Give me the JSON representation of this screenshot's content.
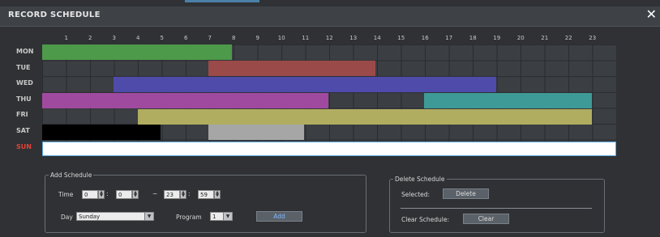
{
  "window": {
    "title": "RECORD SCHEDULE",
    "close_symbol": "✕"
  },
  "hours": [
    "1",
    "2",
    "3",
    "4",
    "5",
    "6",
    "7",
    "8",
    "9",
    "10",
    "11",
    "12",
    "13",
    "14",
    "15",
    "16",
    "17",
    "18",
    "19",
    "20",
    "21",
    "22",
    "23"
  ],
  "days": [
    {
      "label": "MON",
      "color": "#c8c8c8"
    },
    {
      "label": "TUE",
      "color": "#c8c8c8"
    },
    {
      "label": "WED",
      "color": "#c8c8c8"
    },
    {
      "label": "THU",
      "color": "#c8c8c8"
    },
    {
      "label": "FRI",
      "color": "#c8c8c8"
    },
    {
      "label": "SAT",
      "color": "#c8c8c8"
    },
    {
      "label": "SUN",
      "color": "#e0433a"
    }
  ],
  "schedule": {
    "colors": {
      "mon": "#4c9a4a",
      "tue": "#9b4a4a",
      "wed": "#4f4bab",
      "thu": "#a04a9f",
      "thu2": "#3e9a96",
      "fri": "#b1ad60",
      "sat": "#000000",
      "sat2": "#a6a6a6",
      "sun": "#ffffff"
    }
  },
  "add_schedule": {
    "legend": "Add Schedule",
    "time_label": "Time",
    "start_hour": "0",
    "start_min": "0",
    "dash": "~",
    "end_hour": "23",
    "end_min": "59",
    "day_label": "Day",
    "day_value": "Sunday",
    "program_label": "Program",
    "program_value": "1",
    "add_label": "Add"
  },
  "delete_schedule": {
    "legend": "Delete Schedule",
    "selected_label": "Selected:",
    "delete_label": "Delete",
    "clear_label_text": "Clear Schedule:",
    "clear_label": "Clear"
  }
}
